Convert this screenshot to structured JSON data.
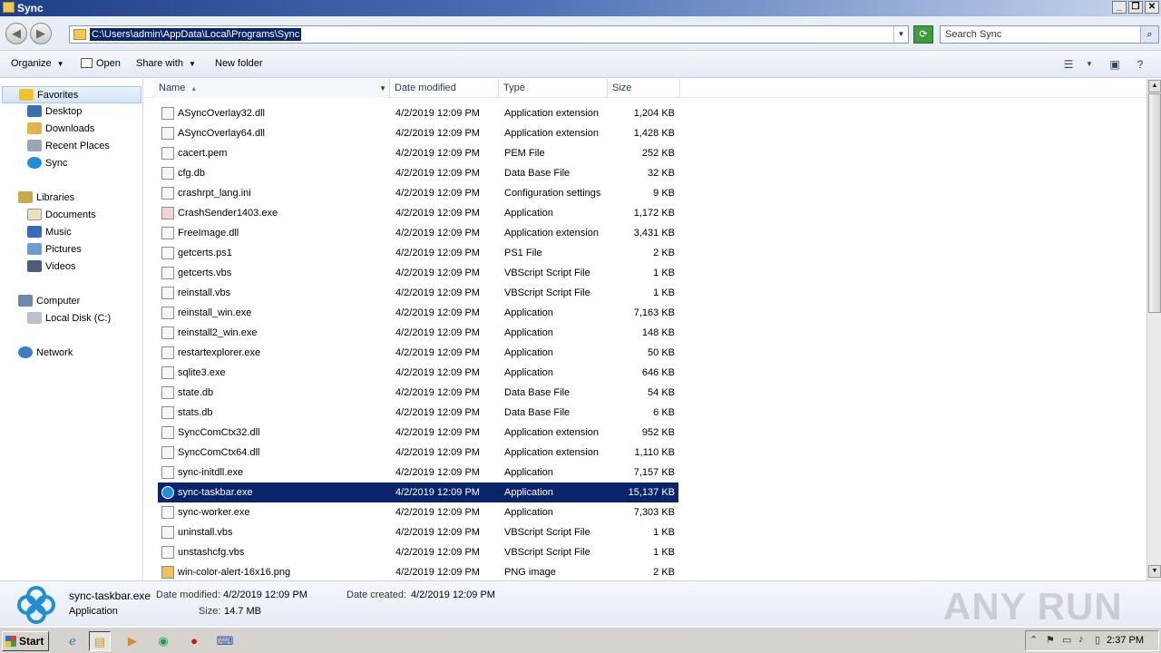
{
  "window": {
    "title": "Sync",
    "controls": {
      "minimize": "_",
      "restore": "❐",
      "close": "✕"
    }
  },
  "address": {
    "path": "C:\\Users\\admin\\AppData\\Local\\Programs\\Sync",
    "search_placeholder": "Search Sync"
  },
  "toolbar": {
    "organize": "Organize",
    "open": "Open",
    "share_with": "Share with",
    "new_folder": "New folder"
  },
  "nav": {
    "favorites": "Favorites",
    "desktop": "Desktop",
    "downloads": "Downloads",
    "recent_places": "Recent Places",
    "sync": "Sync",
    "libraries": "Libraries",
    "documents": "Documents",
    "music": "Music",
    "pictures": "Pictures",
    "videos": "Videos",
    "computer": "Computer",
    "local_disk": "Local Disk (C:)",
    "network": "Network"
  },
  "columns": {
    "name": "Name",
    "date_modified": "Date modified",
    "type": "Type",
    "size": "Size"
  },
  "files": [
    {
      "name": "ASyncOverlay32.dll",
      "date": "4/2/2019 12:09 PM",
      "type": "Application extension",
      "size": "1,204 KB",
      "icon": "dll-icon"
    },
    {
      "name": "ASyncOverlay64.dll",
      "date": "4/2/2019 12:09 PM",
      "type": "Application extension",
      "size": "1,428 KB",
      "icon": "dll-icon"
    },
    {
      "name": "cacert.pem",
      "date": "4/2/2019 12:09 PM",
      "type": "PEM File",
      "size": "252 KB",
      "icon": "blank-file-icon"
    },
    {
      "name": "cfg.db",
      "date": "4/2/2019 12:09 PM",
      "type": "Data Base File",
      "size": "32 KB",
      "icon": "db-file-icon"
    },
    {
      "name": "crashrpt_lang.ini",
      "date": "4/2/2019 12:09 PM",
      "type": "Configuration settings",
      "size": "9 KB",
      "icon": "ini-file-icon"
    },
    {
      "name": "CrashSender1403.exe",
      "date": "4/2/2019 12:09 PM",
      "type": "Application",
      "size": "1,172 KB",
      "icon": "crash-sender-icon"
    },
    {
      "name": "FreeImage.dll",
      "date": "4/2/2019 12:09 PM",
      "type": "Application extension",
      "size": "3,431 KB",
      "icon": "dll-icon"
    },
    {
      "name": "getcerts.ps1",
      "date": "4/2/2019 12:09 PM",
      "type": "PS1 File",
      "size": "2 KB",
      "icon": "ps1-file-icon"
    },
    {
      "name": "getcerts.vbs",
      "date": "4/2/2019 12:09 PM",
      "type": "VBScript Script File",
      "size": "1 KB",
      "icon": "vbs-file-icon"
    },
    {
      "name": "reinstall.vbs",
      "date": "4/2/2019 12:09 PM",
      "type": "VBScript Script File",
      "size": "1 KB",
      "icon": "vbs-file-icon"
    },
    {
      "name": "reinstall_win.exe",
      "date": "4/2/2019 12:09 PM",
      "type": "Application",
      "size": "7,163 KB",
      "icon": "exe-icon"
    },
    {
      "name": "reinstall2_win.exe",
      "date": "4/2/2019 12:09 PM",
      "type": "Application",
      "size": "148 KB",
      "icon": "exe-icon"
    },
    {
      "name": "restartexplorer.exe",
      "date": "4/2/2019 12:09 PM",
      "type": "Application",
      "size": "50 KB",
      "icon": "exe-icon"
    },
    {
      "name": "sqlite3.exe",
      "date": "4/2/2019 12:09 PM",
      "type": "Application",
      "size": "646 KB",
      "icon": "exe-icon"
    },
    {
      "name": "state.db",
      "date": "4/2/2019 12:09 PM",
      "type": "Data Base File",
      "size": "54 KB",
      "icon": "db-file-icon"
    },
    {
      "name": "stats.db",
      "date": "4/2/2019 12:09 PM",
      "type": "Data Base File",
      "size": "6 KB",
      "icon": "db-file-icon"
    },
    {
      "name": "SyncComCtx32.dll",
      "date": "4/2/2019 12:09 PM",
      "type": "Application extension",
      "size": "952 KB",
      "icon": "dll-icon"
    },
    {
      "name": "SyncComCtx64.dll",
      "date": "4/2/2019 12:09 PM",
      "type": "Application extension",
      "size": "1,110 KB",
      "icon": "dll-icon"
    },
    {
      "name": "sync-initdll.exe",
      "date": "4/2/2019 12:09 PM",
      "type": "Application",
      "size": "7,157 KB",
      "icon": "exe-icon"
    },
    {
      "name": "sync-taskbar.exe",
      "date": "4/2/2019 12:09 PM",
      "type": "Application",
      "size": "15,137 KB",
      "icon": "sync-app-icon",
      "selected": true
    },
    {
      "name": "sync-worker.exe",
      "date": "4/2/2019 12:09 PM",
      "type": "Application",
      "size": "7,303 KB",
      "icon": "exe-icon"
    },
    {
      "name": "uninstall.vbs",
      "date": "4/2/2019 12:09 PM",
      "type": "VBScript Script File",
      "size": "1 KB",
      "icon": "vbs-file-icon"
    },
    {
      "name": "unstashcfg.vbs",
      "date": "4/2/2019 12:09 PM",
      "type": "VBScript Script File",
      "size": "1 KB",
      "icon": "vbs-file-icon"
    },
    {
      "name": "win-color-alert-16x16.png",
      "date": "4/2/2019 12:09 PM",
      "type": "PNG image",
      "size": "2 KB",
      "icon": "png-file-icon"
    }
  ],
  "details": {
    "name": "sync-taskbar.exe",
    "type": "Application",
    "modified_label": "Date modified:",
    "modified_value": "4/2/2019 12:09 PM",
    "created_label": "Date created:",
    "created_value": "4/2/2019 12:09 PM",
    "size_label": "Size:",
    "size_value": "14.7 MB"
  },
  "watermark": "ANY RUN",
  "taskbar": {
    "start": "Start",
    "clock": "2:37 PM"
  },
  "colors": {
    "selection": "#0a246a",
    "title_gradient_start": "#1f3f86",
    "sync_blue": "#1e8fd5"
  }
}
